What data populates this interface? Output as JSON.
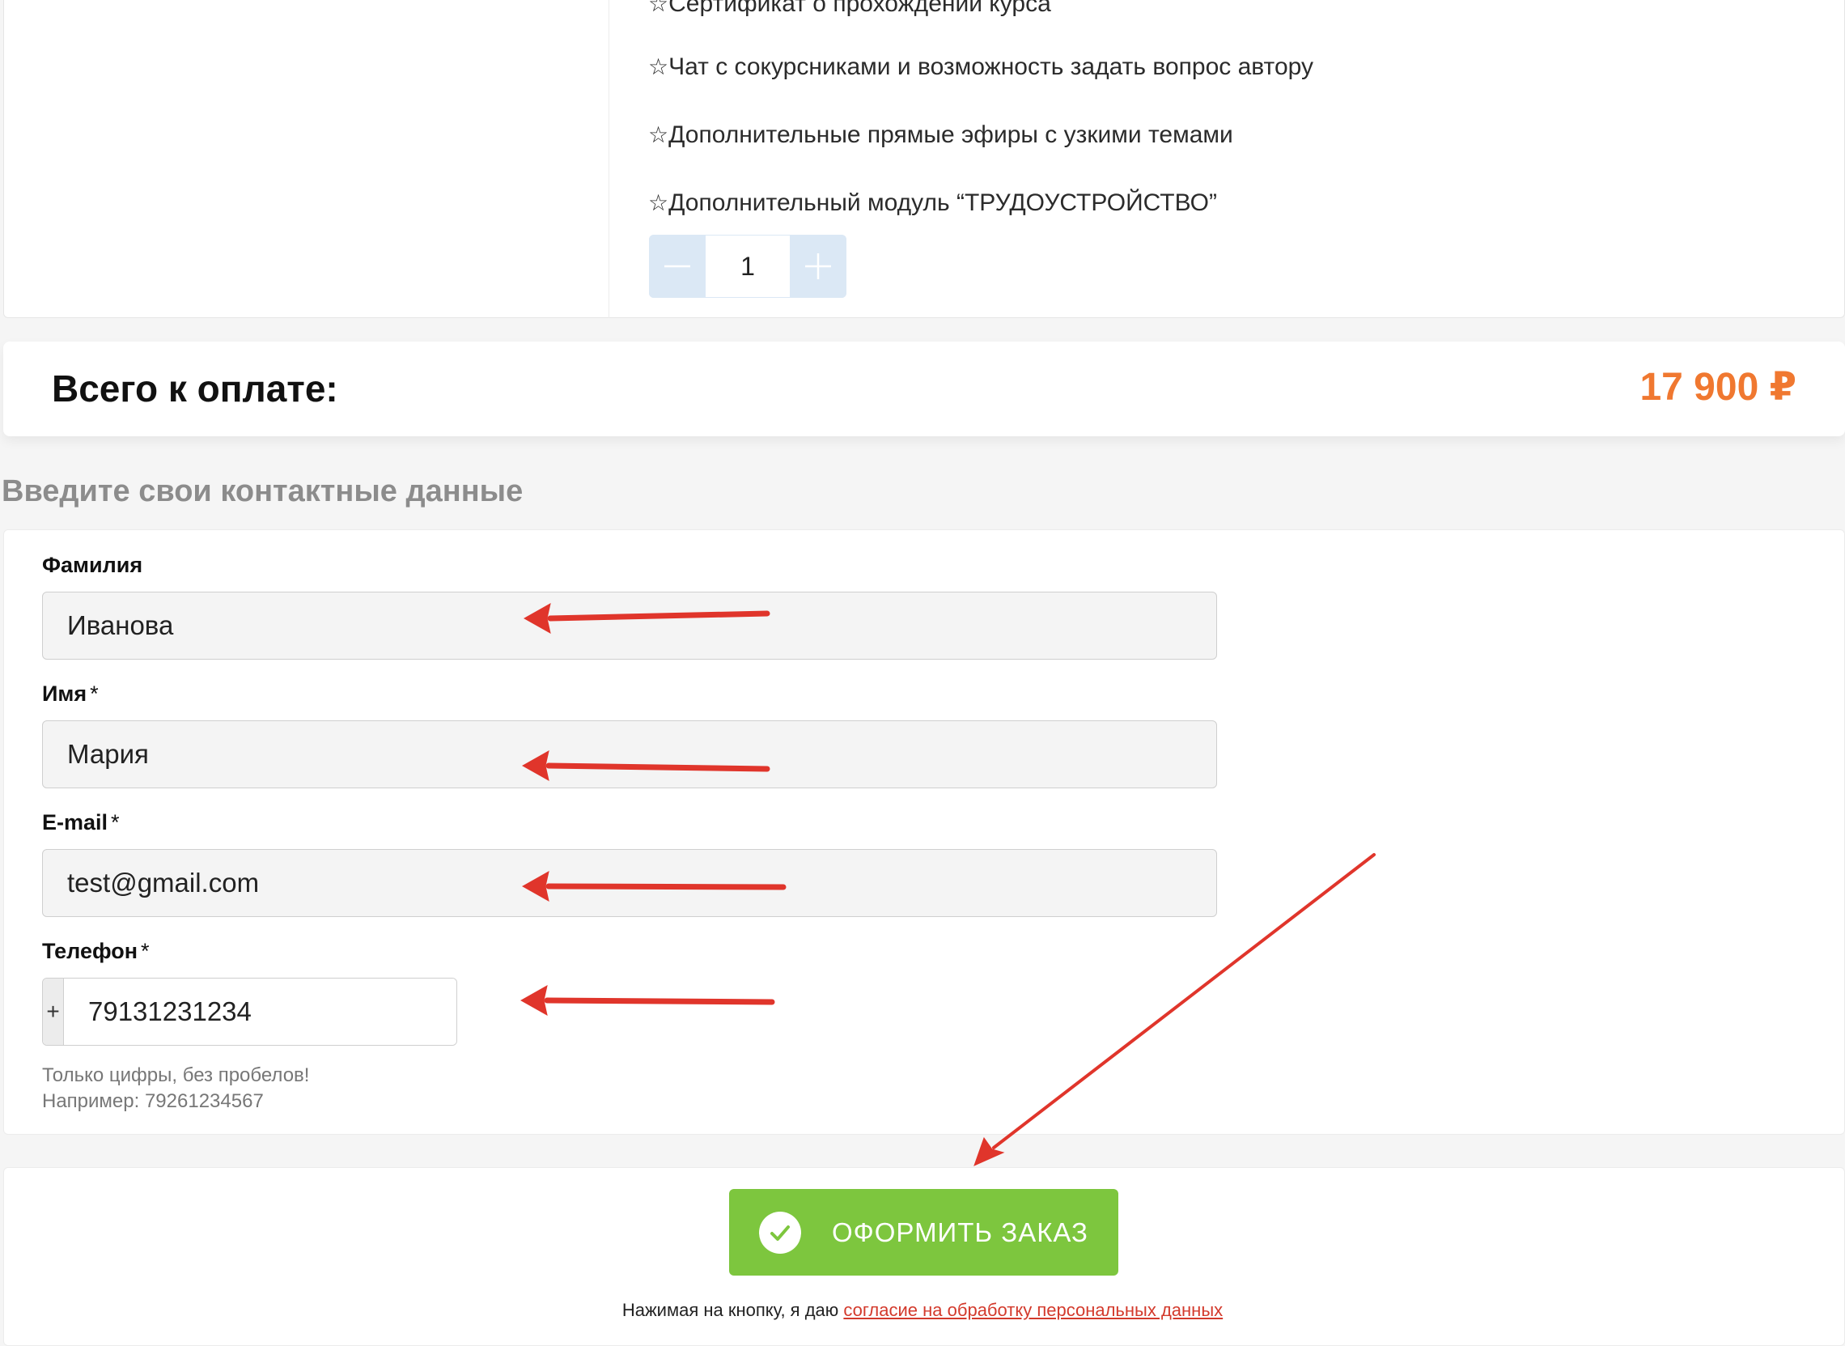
{
  "product": {
    "features": [
      {
        "star": "☆",
        "text": "Сертификат о прохождении курса"
      },
      {
        "star": "☆",
        "text": "Чат с сокурсниками и возможность задать вопрос автору"
      },
      {
        "star": "☆",
        "text": "Дополнительные прямые эфиры с узкими темами"
      },
      {
        "star": "☆",
        "text": "Дополнительный модуль “ТРУДОУСТРОЙСТВО”"
      }
    ],
    "quantity": "1",
    "decrement_icon": "minus-icon",
    "increment_icon": "plus-icon"
  },
  "total": {
    "label": "Всего к оплате:",
    "value": "17 900 ₽"
  },
  "contacts": {
    "title": "Введите свои контактные данные",
    "fields": {
      "last_name": {
        "label": "Фамилия",
        "required_mark": "",
        "value": "Иванова"
      },
      "first_name": {
        "label": "Имя",
        "required_mark": "*",
        "value": "Мария"
      },
      "email": {
        "label": "E-mail",
        "required_mark": "*",
        "value": "test@gmail.com"
      },
      "phone": {
        "label": "Телефон",
        "required_mark": "*",
        "prefix": "+",
        "value": "79131231234"
      }
    },
    "phone_hint_1": "Только цифры, без пробелов!",
    "phone_hint_2": "Например: 79261234567"
  },
  "submit": {
    "label": "ОФОРМИТЬ ЗАКАЗ",
    "icon": "check-circle-icon",
    "consent_prefix": "Нажимая на кнопку, я даю ",
    "consent_link": "согласие на обработку персональных данных"
  },
  "colors": {
    "accent_total": "#f07830",
    "button_green": "#7dc63e",
    "annotation_arrow": "#e0352b",
    "consent_link": "#d33a2c",
    "stepper_blue": "#dbe8f5"
  }
}
